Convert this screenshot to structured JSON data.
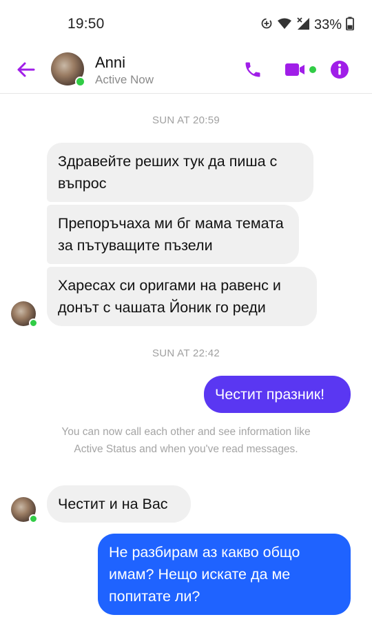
{
  "status_bar": {
    "time": "19:50",
    "battery": "33%",
    "icons": [
      "data-saver-icon",
      "wifi-icon",
      "signal-icon",
      "battery-icon"
    ]
  },
  "header": {
    "name": "Anni",
    "status": "Active Now",
    "accent_color": "#a01ee8",
    "online_color": "#31cc46"
  },
  "chat": {
    "timestamp_1": "SUN AT 20:59",
    "messages_1": [
      "Здравейте реших тук да пиша с въпрос",
      "Препоръчаха ми бг мама темата за пътуващите пъзели",
      "Харесах си оригами на равенс и донът с чашата Йоник го реди"
    ],
    "timestamp_2": "SUN AT 22:42",
    "outgoing_1": "Честит празник!",
    "notice": "You can now call each other and see information like Active Status and when you've read messages.",
    "incoming_2": "Честит и на Вас",
    "outgoing_2": "Не разбирам аз какво общо имам? Нещо искате да ме попитате ли?",
    "colors": {
      "outgoing_1": "#5a37f2",
      "outgoing_2": "#1f63ff",
      "incoming": "#f0f0f0"
    }
  }
}
